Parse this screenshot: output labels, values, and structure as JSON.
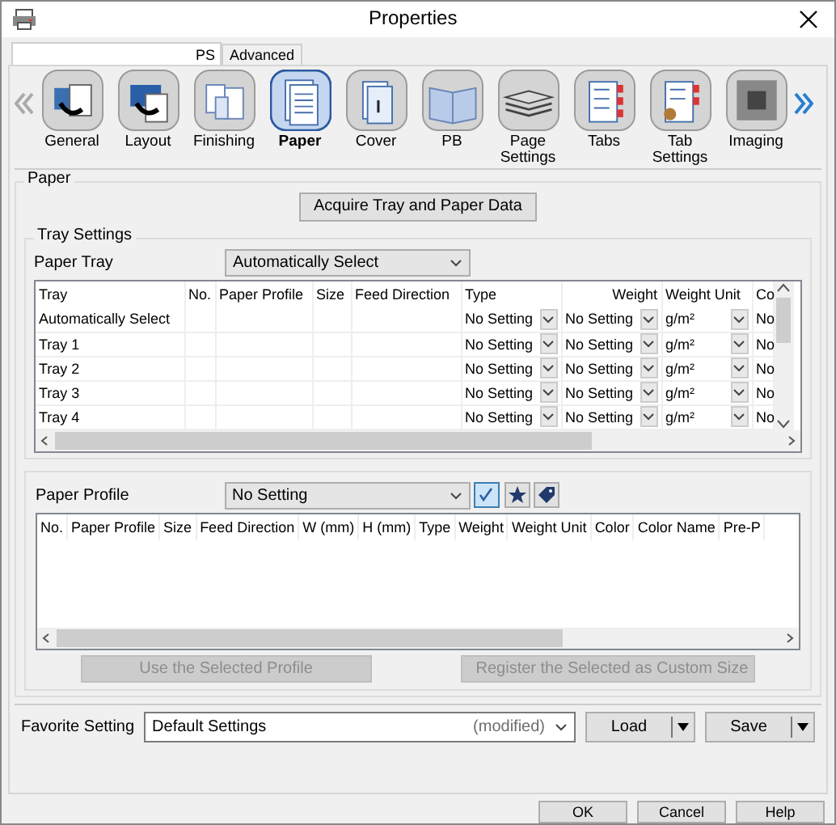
{
  "window": {
    "title": "Properties"
  },
  "tabs": [
    {
      "label": "PS",
      "selected": true
    },
    {
      "label": "Advanced",
      "selected": false
    }
  ],
  "categories": [
    {
      "label": "General",
      "kind": "general",
      "selected": false
    },
    {
      "label": "Layout",
      "kind": "layout",
      "selected": false
    },
    {
      "label": "Finishing",
      "kind": "finishing",
      "selected": false
    },
    {
      "label": "Paper",
      "kind": "paper",
      "selected": true
    },
    {
      "label": "Cover",
      "kind": "cover",
      "selected": false
    },
    {
      "label": "PB",
      "kind": "book",
      "selected": false
    },
    {
      "label": "Page Settings",
      "kind": "stack",
      "selected": false
    },
    {
      "label": "Tabs",
      "kind": "tabs",
      "selected": false
    },
    {
      "label": "Tab Settings",
      "kind": "tabsettings",
      "selected": false
    },
    {
      "label": "Imaging",
      "kind": "imaging",
      "selected": false
    }
  ],
  "paper": {
    "title": "Paper",
    "acquire_button": "Acquire Tray and Paper Data",
    "tray_settings": {
      "title": "Tray Settings",
      "paper_tray": {
        "label": "Paper Tray",
        "value": "Automatically Select"
      },
      "table": {
        "columns": [
          "Tray",
          "No.",
          "Paper Profile",
          "Size",
          "Feed Direction",
          "Type",
          "Weight",
          "Weight Unit",
          "Co"
        ],
        "rows": [
          {
            "tray": "Automatically Select",
            "type": "No Setting",
            "weight": "No Setting",
            "weight_unit": "g/m²",
            "column_9": "No"
          },
          {
            "tray": "Tray 1",
            "type": "No Setting",
            "weight": "No Setting",
            "weight_unit": "g/m²",
            "column_9": "No"
          },
          {
            "tray": "Tray 2",
            "type": "No Setting",
            "weight": "No Setting",
            "weight_unit": "g/m²",
            "column_9": "No"
          },
          {
            "tray": "Tray 3",
            "type": "No Setting",
            "weight": "No Setting",
            "weight_unit": "g/m²",
            "column_9": "No"
          },
          {
            "tray": "Tray 4",
            "type": "No Setting",
            "weight": "No Setting",
            "weight_unit": "g/m²",
            "column_9": "No"
          }
        ]
      }
    },
    "paper_profile": {
      "label": "Paper Profile",
      "value": "No Setting",
      "tools": [
        {
          "kind": "check",
          "selected": true
        },
        {
          "kind": "star",
          "selected": false
        },
        {
          "kind": "tag",
          "selected": false
        }
      ],
      "table": {
        "columns": [
          "No.",
          "Paper Profile",
          "Size",
          "Feed Direction",
          "W (mm)",
          "H (mm)",
          "Type",
          "Weight",
          "Weight Unit",
          "Color",
          "Color Name",
          "Pre-P"
        ]
      },
      "buttons": [
        {
          "label": "Use the Selected Profile",
          "disabled": true
        },
        {
          "label": "Register the Selected as Custom Size",
          "disabled": true
        }
      ]
    }
  },
  "favorite": {
    "label": "Favorite Setting",
    "value": "Default Settings",
    "note": "(modified)",
    "buttons": [
      "Load",
      "Save"
    ]
  },
  "buttons": [
    "OK",
    "Cancel",
    "Help"
  ]
}
